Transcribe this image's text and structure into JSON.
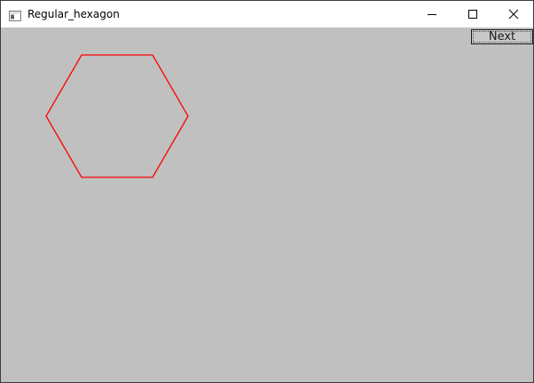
{
  "window": {
    "title": "Regular_hexagon",
    "background_color": "#bfc0bf"
  },
  "titlebar": {
    "app_icon": "window-app-icon",
    "minimize_icon": "minimize-icon",
    "maximize_icon": "maximize-icon",
    "close_icon": "close-icon"
  },
  "controls": {
    "next_label": "Next"
  },
  "shape": {
    "type": "regular hexagon",
    "stroke_color": "#ff0000"
  }
}
